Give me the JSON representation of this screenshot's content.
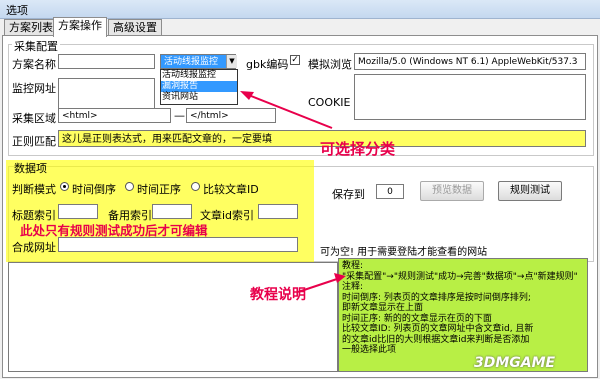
{
  "window": {
    "title": "选项"
  },
  "tabs": [
    "方案列表",
    "方案操作",
    "高级设置"
  ],
  "group_capture": {
    "title": "采集配置"
  },
  "scheme_name": {
    "label": "方案名称",
    "value": "",
    "category_value": "活动线报监控"
  },
  "category_options": [
    "活动线报监控",
    "漏洞报告",
    "资讯网站"
  ],
  "gbk": {
    "label": "gbk编码",
    "checked": "✓"
  },
  "user_agent": {
    "label": "模拟浏览",
    "value": "Mozilla/5.0 (Windows NT 6.1) AppleWebKit/537.3"
  },
  "monitor_url": {
    "label": "监控网址"
  },
  "cookie": {
    "label": "COOKIE"
  },
  "capture_area": {
    "label": "采集区域",
    "start": "<html>",
    "sep": "—",
    "end": "</html>"
  },
  "regex": {
    "label": "正则匹配",
    "value": "这儿是正则表达式，用来匹配文章的，一定要填"
  },
  "annotation_category": "可选择分类",
  "group_data": {
    "title": "数据项"
  },
  "sort_mode": {
    "label": "判断模式",
    "options": [
      "时间倒序",
      "时间正序",
      "比较文章ID"
    ],
    "selected": 0
  },
  "save_to": {
    "label": "保存到",
    "value": "0"
  },
  "preview_button": "预览数据",
  "test_button": "规则测试",
  "title_index": {
    "label": "标题索引"
  },
  "alt_index": {
    "label": "备用索引"
  },
  "article_id": {
    "label": "文章id索引"
  },
  "combine_url": {
    "label": "合成网址"
  },
  "annotation_editable": "此处只有规则测试成功后才可编辑",
  "empty_hint": "可为空! 用于需要登陆才能查看的网站",
  "annotation_tutorial": "教程说明",
  "tutorial_lines": [
    "教程:",
    "\"采集配置\"→\"规则测试\"成功→完善\"数据项\"→点\"新建规则\"",
    "注释:",
    "时间倒序: 列表页的文章排序是按时间倒序排列;",
    "即新文章显示在上面",
    "时间正序: 新的的文章显示在页的下面",
    "比较文章ID: 列表页的文章网址中含文章id, 且新",
    "的文章id比旧的大则根据文章id来判断是否添加",
    "一般选择此项"
  ],
  "watermark": "3DMGAME",
  "colors": {
    "annotation_red": "#e8004b",
    "highlight_yellow": "#ffff00",
    "selection_blue": "#3399ff"
  }
}
